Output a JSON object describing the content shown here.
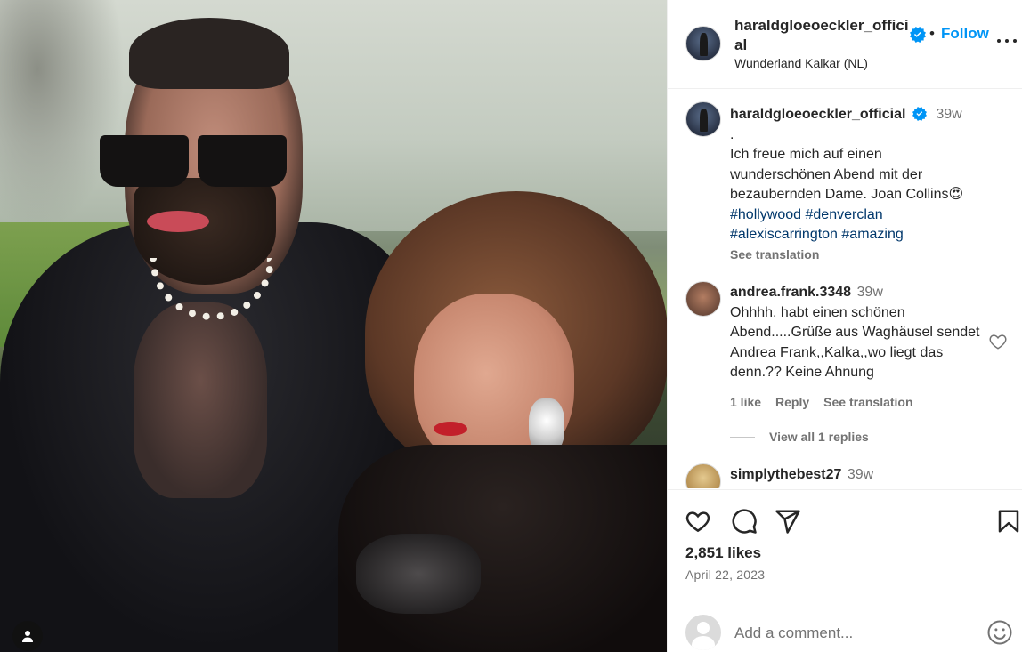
{
  "post": {
    "photo": {
      "user_tag_icon": "person-icon"
    },
    "header": {
      "username": "haraldgloeoeckler_official",
      "dot": "•",
      "follow_label": "Follow",
      "location": "Wunderland Kalkar (NL)"
    },
    "caption": {
      "username": "haraldgloeoeckler_official",
      "time": "39w",
      "lines": [
        ".",
        "Ich freue mich auf einen",
        "wunderschönen Abend mit der",
        "bezaubernden Dame. Joan Collins😍"
      ],
      "hashtags_line1": "#hollywood #denverclan",
      "hashtags_line2": "#alexiscarrington #amazing",
      "see_translation": "See translation"
    },
    "comments": [
      {
        "username": "andrea.frank.3348",
        "time": "39w",
        "text": "Ohhhh, habt einen schönen Abend.....Grüße aus Waghäusel sendet Andrea Frank,,Kalka,,wo liegt das denn.?? Keine Ahnung",
        "likes": "1 like",
        "reply": "Reply",
        "see_translation": "See translation",
        "view_replies": "View all 1 replies"
      },
      {
        "username": "simplythebest27",
        "time": "39w"
      }
    ],
    "likes": "2,851 likes",
    "date": "April 22, 2023",
    "add_comment_placeholder": "Add a comment...",
    "brand_color": "#0095f6"
  }
}
